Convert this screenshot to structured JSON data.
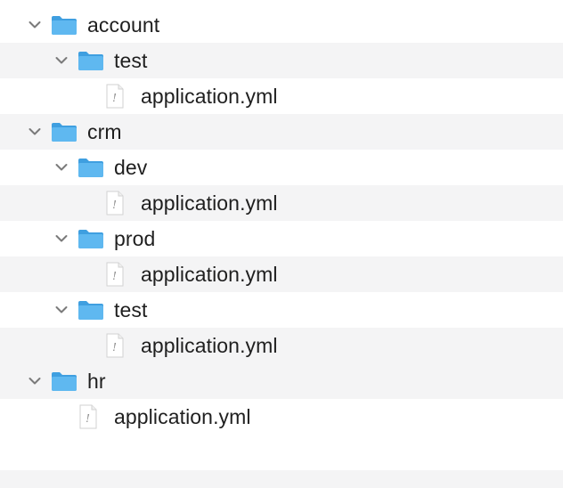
{
  "tree": {
    "account": {
      "label": "account",
      "test": {
        "label": "test",
        "file": "application.yml"
      }
    },
    "crm": {
      "label": "crm",
      "dev": {
        "label": "dev",
        "file": "application.yml"
      },
      "prod": {
        "label": "prod",
        "file": "application.yml"
      },
      "test": {
        "label": "test",
        "file": "application.yml"
      }
    },
    "hr": {
      "label": "hr",
      "file": "application.yml"
    }
  },
  "icons": {
    "folder": "folder-icon",
    "file": "yaml-file-icon",
    "disclosure": "chevron-down-icon"
  },
  "colors": {
    "folder_front": "#5fb8f0",
    "folder_back": "#3f9fe0",
    "chevron": "#7a7a7a",
    "row_alt": "#f4f4f5",
    "text": "#1f1f1f"
  }
}
